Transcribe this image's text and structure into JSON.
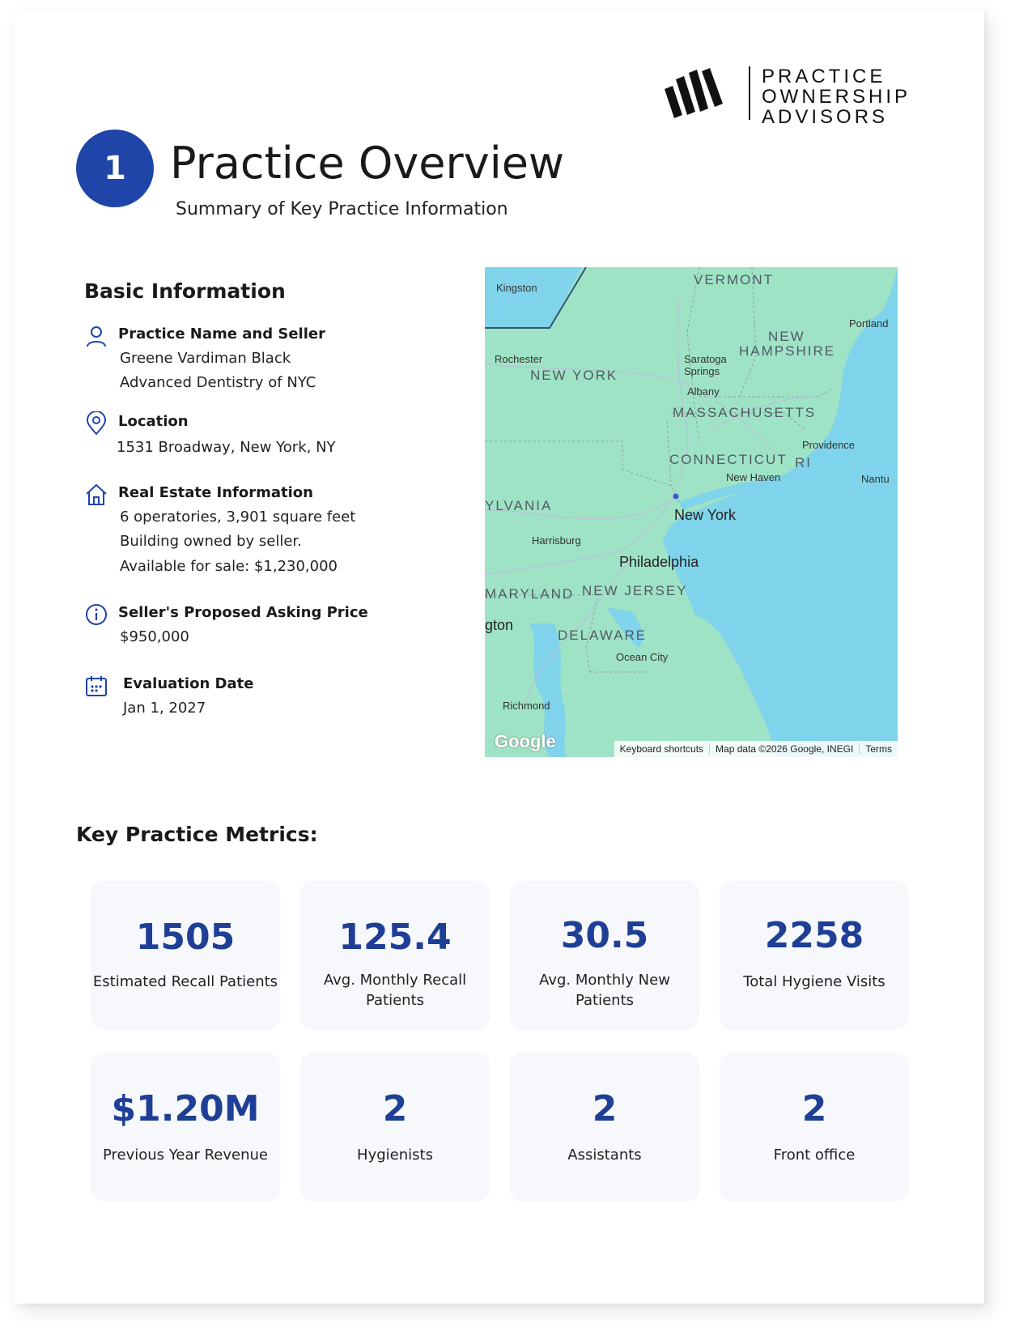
{
  "brand": {
    "line1": "PRACTICE",
    "line2": "OWNERSHIP",
    "line3": "ADVISORS"
  },
  "section": {
    "number": "1",
    "title": "Practice Overview",
    "subtitle": "Summary of Key Practice Information"
  },
  "basic_info": {
    "heading": "Basic Information",
    "items": [
      {
        "icon": "person-icon",
        "label": "Practice Name and Seller",
        "values": [
          "Greene Vardiman Black",
          "Advanced Dentistry of NYC"
        ]
      },
      {
        "icon": "location-pin-icon",
        "label": "Location",
        "values": [
          "1531 Broadway, New York, NY"
        ]
      },
      {
        "icon": "house-icon",
        "label": "Real Estate Information",
        "values": [
          "6 operatories, 3,901 square feet",
          "Building owned by seller.",
          "Available for sale: $1,230,000"
        ]
      },
      {
        "icon": "info-icon",
        "label": "Seller's Proposed Asking Price",
        "values": [
          "$950,000"
        ]
      },
      {
        "icon": "calendar-icon",
        "label": "Evaluation Date",
        "values": [
          "Jan 1, 2027"
        ]
      }
    ]
  },
  "map": {
    "states": [
      "VERMONT",
      "NEW",
      "HAMPSHIRE",
      "NEW YORK",
      "MASSACHUSETTS",
      "CONNECTICUT",
      "RI",
      "YLVANIA",
      "MARYLAND",
      "NEW JERSEY",
      "DELAWARE"
    ],
    "cities": [
      "Kingston",
      "Portland",
      "Rochester",
      "Saratoga",
      "Springs",
      "Albany",
      "Providence",
      "New Haven",
      "Nantu",
      "New York",
      "Harrisburg",
      "Philadelphia",
      "gton",
      "Ocean City",
      "Richmond"
    ],
    "footer": {
      "google": "Google",
      "shortcuts": "Keyboard shortcuts",
      "mapdata": "Map data ©2026 Google, INEGI",
      "terms": "Terms"
    },
    "land_color": "#9fe3c6",
    "water_color": "#7fd3ea"
  },
  "metrics": {
    "heading": "Key Practice Metrics:",
    "cards": [
      {
        "value": "1505",
        "caption": "Estimated Recall Patients"
      },
      {
        "value": "125.4",
        "caption": "Avg. Monthly Recall Patients"
      },
      {
        "value": "30.5",
        "caption": "Avg. Monthly New Patients"
      },
      {
        "value": "2258",
        "caption": "Total Hygiene Visits"
      },
      {
        "value": "$1.20M",
        "caption": "Previous Year Revenue"
      },
      {
        "value": "2",
        "caption": "Hygienists"
      },
      {
        "value": "2",
        "caption": "Assistants"
      },
      {
        "value": "2",
        "caption": "Front office"
      }
    ]
  },
  "colors": {
    "accent": "#1f45a8",
    "metric": "#1f3f96",
    "card_bg": "#f6f8fb"
  }
}
